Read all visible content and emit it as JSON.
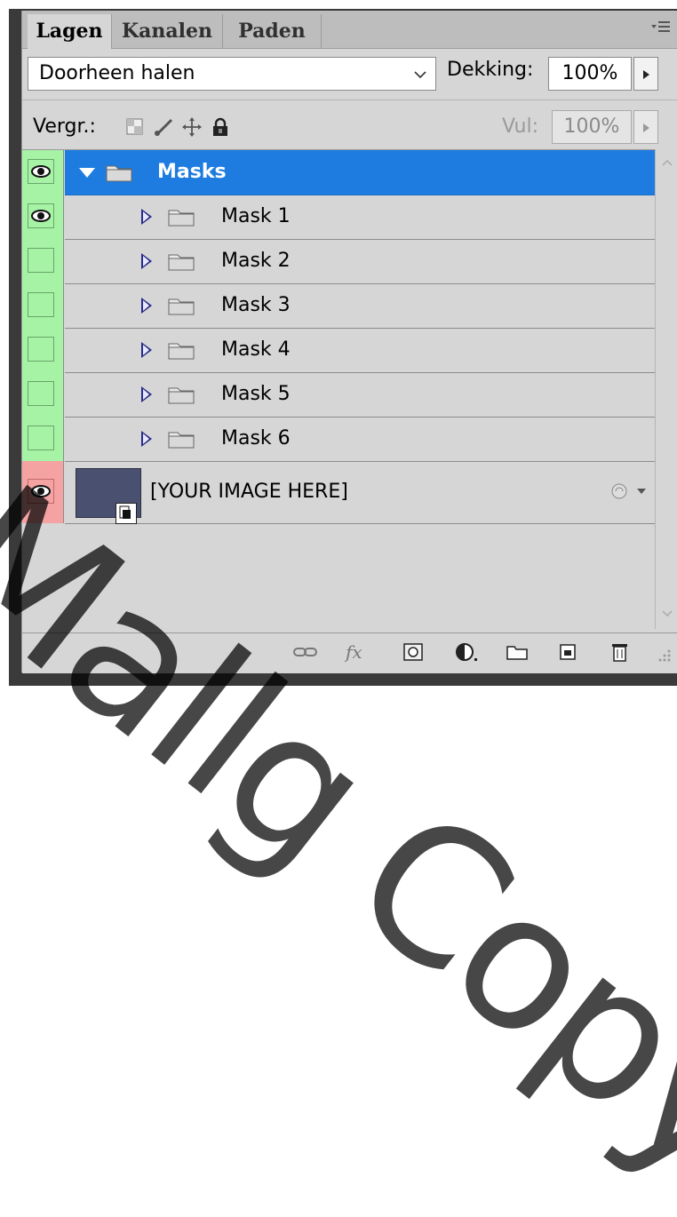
{
  "tabs": [
    "Lagen",
    "Kanalen",
    "Paden"
  ],
  "blend_mode": "Doorheen halen",
  "opacity": {
    "label": "Dekking:",
    "value": "100%"
  },
  "lock": {
    "label": "Vergr.:"
  },
  "fill": {
    "label": "Vul:",
    "value": "100%"
  },
  "layers": [
    {
      "name": "Masks",
      "type": "group",
      "expanded": true,
      "selected": true,
      "visible": true,
      "eye_color": "#a6f3a6"
    },
    {
      "name": "Mask 1",
      "type": "group",
      "expanded": false,
      "visible": true,
      "eye_color": "#a6f3a6"
    },
    {
      "name": "Mask 2",
      "type": "group",
      "expanded": false,
      "visible": false,
      "eye_color": "#a6f3a6"
    },
    {
      "name": "Mask 3",
      "type": "group",
      "expanded": false,
      "visible": false,
      "eye_color": "#a6f3a6"
    },
    {
      "name": "Mask 4",
      "type": "group",
      "expanded": false,
      "visible": false,
      "eye_color": "#a6f3a6"
    },
    {
      "name": "Mask 5",
      "type": "group",
      "expanded": false,
      "visible": false,
      "eye_color": "#a6f3a6"
    },
    {
      "name": "Mask 6",
      "type": "group",
      "expanded": false,
      "visible": false,
      "eye_color": "#a6f3a6"
    },
    {
      "name": "[YOUR IMAGE HERE]",
      "type": "smart-object",
      "visible": true,
      "eye_color": "#f4a2a2"
    }
  ],
  "bottom_tools": [
    "link-layers-icon",
    "fx-icon",
    "layer-mask-icon",
    "adjustment-layer-icon",
    "new-group-icon",
    "new-layer-icon",
    "trash-icon"
  ],
  "watermark": "Mallg Copy",
  "colors": {
    "selection": "#1e7ce0",
    "visible_green": "#a6f3a6",
    "visible_red": "#f4a2a2"
  }
}
